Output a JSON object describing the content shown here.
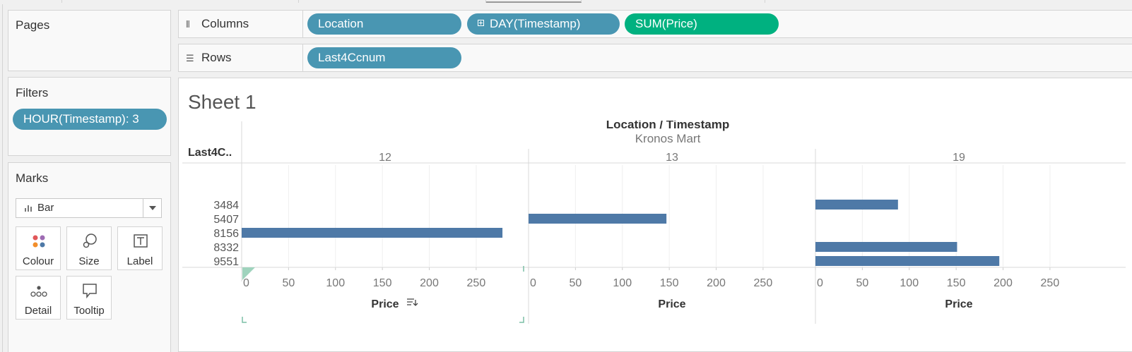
{
  "shelves": {
    "columns_label": "Columns",
    "rows_label": "Rows",
    "columns_pills": [
      "Location",
      "DAY(Timestamp)",
      "SUM(Price)"
    ],
    "rows_pills": [
      "Last4Ccnum"
    ]
  },
  "cards": {
    "pages_title": "Pages",
    "filters_title": "Filters",
    "filter_pill": "HOUR(Timestamp): 3",
    "marks_title": "Marks",
    "mark_type": "Bar",
    "mark_buttons": [
      "Colour",
      "Size",
      "Label",
      "Detail",
      "Tooltip"
    ]
  },
  "sheet": {
    "title": "Sheet 1"
  },
  "chart_data": {
    "type": "bar",
    "title": "Location / Timestamp",
    "subtitle": "Kronos Mart",
    "row_header": "Last4C..",
    "categories": [
      "3484",
      "5407",
      "8156",
      "8332",
      "9551"
    ],
    "panels": [
      {
        "name": "12",
        "xlabel": "Price",
        "values": [
          null,
          null,
          278,
          null,
          null
        ]
      },
      {
        "name": "13",
        "xlabel": "Price",
        "values": [
          null,
          147,
          null,
          null,
          null
        ]
      },
      {
        "name": "19",
        "xlabel": "Price",
        "values": [
          88,
          null,
          null,
          151,
          196
        ]
      }
    ],
    "xlim": [
      0,
      290
    ],
    "xticks": [
      "0",
      "50",
      "100",
      "150",
      "200",
      "250"
    ],
    "bar_color": "#4e79a7",
    "grid": true
  }
}
